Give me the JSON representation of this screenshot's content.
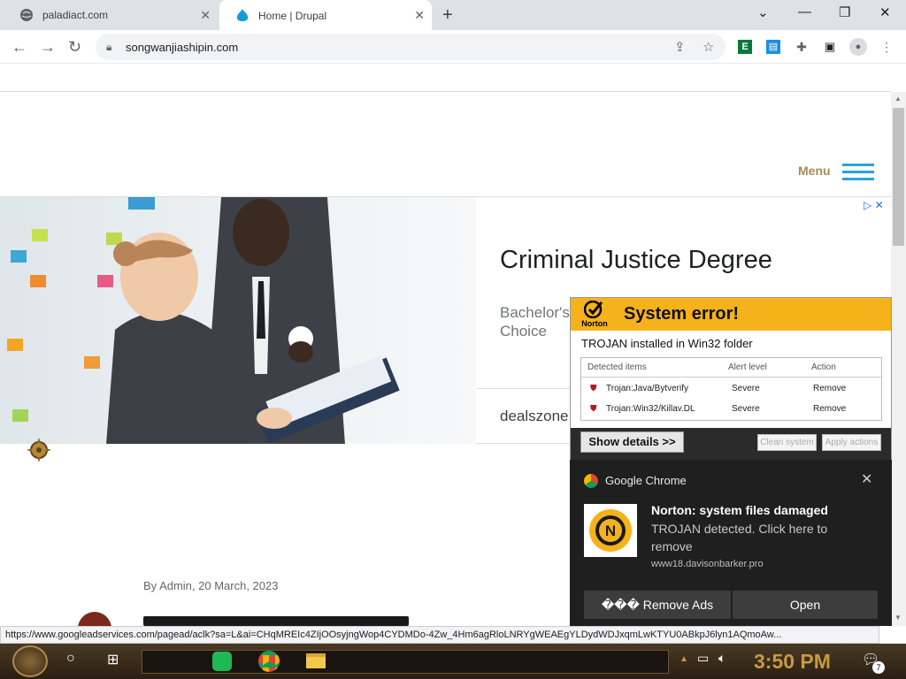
{
  "browser": {
    "tabs": [
      {
        "title": "paladiact.com",
        "active": false
      },
      {
        "title": "Home | Drupal",
        "active": true
      }
    ],
    "new_tab": "+",
    "url": "songwanjiashipin.com",
    "status_url": "https://www.googleadservices.com/pagead/aclk?sa=L&ai=CHqMREIc4ZIjOOsyjngWop4CYDMDo-4Zw_4Hm6agRloLNRYgWEAEgYLDydWDJxqmLwKTYU0ABkpJ6lyn1AQmoAw..."
  },
  "site": {
    "menu_label": "Menu",
    "byline": "By Admin, 20 March, 2023"
  },
  "ad": {
    "title": "Criminal Justice Degree",
    "subtitle": "Bachelor's Choice",
    "domain": "dealszone"
  },
  "norton": {
    "brand": "Norton",
    "title": "System error!",
    "message": "TROJAN installed in Win32 folder",
    "columns": [
      "Detected items",
      "Alert level",
      "Action"
    ],
    "rows": [
      {
        "item": "Trojan:Java/Bytverify",
        "level": "Severe",
        "action": "Remove"
      },
      {
        "item": "Trojan:Win32/Killav.DL",
        "level": "Severe",
        "action": "Remove"
      }
    ],
    "show_details": "Show details >>",
    "clean_system": "Clean system",
    "apply_actions": "Apply actions"
  },
  "notification": {
    "app": "Google Chrome",
    "title": "Norton: system files damaged",
    "body": "TROJAN detected. Click here to remove",
    "source": "www18.davisonbarker.pro",
    "remove_ads": "��� Remove Ads",
    "open": "Open"
  },
  "taskbar": {
    "time": "3:50 PM",
    "notification_count": "7"
  },
  "colors": {
    "norton_header": "#f6b21a",
    "menu_accent": "#2aa3d8",
    "clock": "#c79a3f"
  }
}
